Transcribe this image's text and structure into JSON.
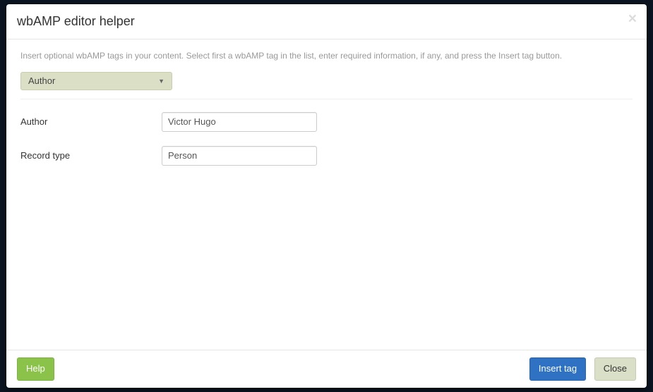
{
  "modal": {
    "title": "wbAMP editor helper",
    "intro": "Insert optional wbAMP tags in your content. Select first a wbAMP tag in the list, enter required information, if any, and press the Insert tag button.",
    "tag_select": {
      "selected": "Author"
    },
    "fields": {
      "author": {
        "label": "Author",
        "value": "Victor Hugo"
      },
      "record_type": {
        "label": "Record type",
        "value": "Person"
      }
    }
  },
  "footer": {
    "help": "Help",
    "insert": "Insert tag",
    "close": "Close"
  }
}
